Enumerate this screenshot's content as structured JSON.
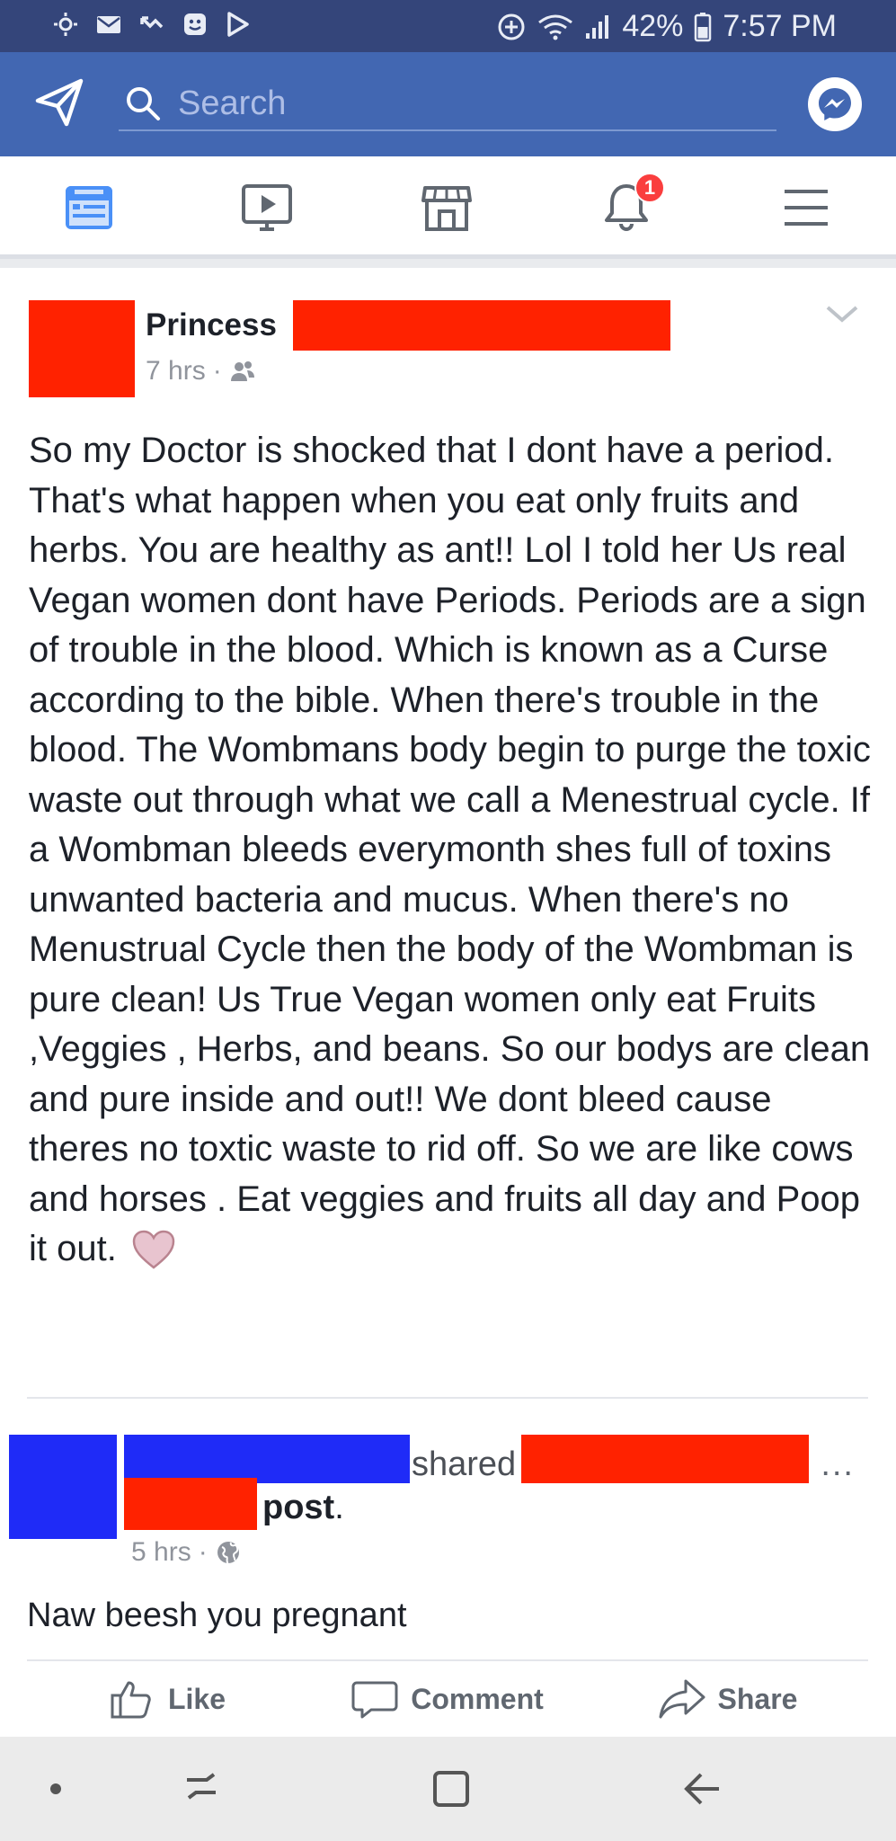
{
  "status_bar": {
    "battery": "42%",
    "time": "7:57 PM"
  },
  "search": {
    "placeholder": "Search"
  },
  "nav": {
    "notifications_badge": "1"
  },
  "post": {
    "author_visible": "Princess",
    "time": "7 hrs",
    "privacy_icon": "friends-icon",
    "text": "So my Doctor is shocked that I dont have a period. That's what happen when you eat only fruits and herbs. You are healthy as ant!! Lol I told her Us real Vegan women dont have Periods. Periods are a sign of trouble in the blood. Which is known as a Curse according to the bible. When there's trouble in the blood. The Wombmans body begin to purge the toxic waste out through what we call a Menestrual cycle. If a Wombman bleeds everymonth shes full of toxins unwanted bacteria and mucus. When there's no Menustrual Cycle then the body of the Wombman is pure clean! Us True Vegan women only eat Fruits ,Veggies , Herbs, and beans. So our bodys are clean and pure inside and out!! We dont bleed cause theres no toxtic waste to rid off. So we are like cows and horses . Eat veggies and fruits all day and Poop it out."
  },
  "share": {
    "shared_word": "shared",
    "post_word": "post",
    "period": ".",
    "more": "...",
    "time": "5 hrs",
    "privacy_icon": "globe-icon",
    "text": "Naw beesh you pregnant"
  },
  "actions": {
    "like": "Like",
    "comment": "Comment",
    "share": "Share"
  },
  "colors": {
    "header_blue": "#4267b2",
    "status_bar": "#34457a",
    "redaction_red": "#ff2200",
    "redaction_blue": "#1f2bf7"
  }
}
